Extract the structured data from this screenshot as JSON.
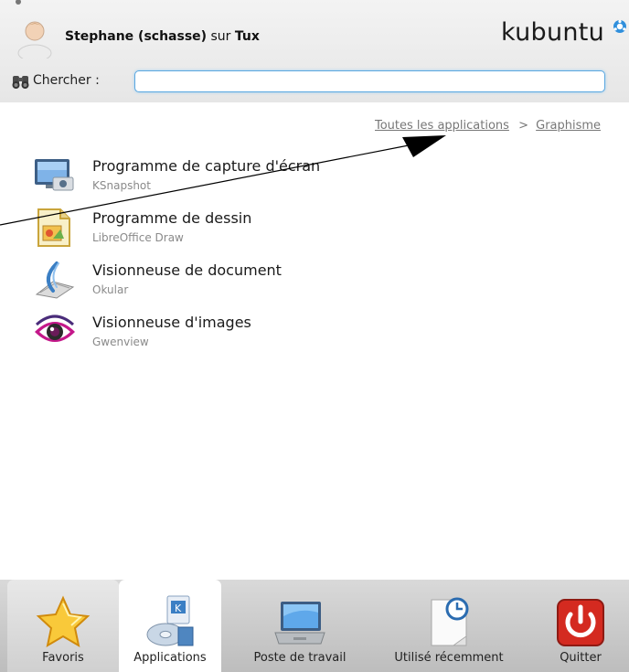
{
  "header": {
    "user_name": "Stephane (schasse)",
    "connector": "sur",
    "host": "Tux",
    "brand": "kubuntu"
  },
  "search": {
    "label": "Chercher :",
    "value": "",
    "placeholder": ""
  },
  "breadcrumb": {
    "root": "Toutes les applications",
    "separator": ">",
    "current": "Graphisme"
  },
  "apps": [
    {
      "title": "Programme de capture d'écran",
      "subtitle": "KSnapshot",
      "icon": "ksnapshot-icon"
    },
    {
      "title": "Programme de dessin",
      "subtitle": "LibreOffice Draw",
      "icon": "libreoffice-draw-icon"
    },
    {
      "title": "Visionneuse de document",
      "subtitle": "Okular",
      "icon": "okular-icon"
    },
    {
      "title": "Visionneuse d'images",
      "subtitle": "Gwenview",
      "icon": "gwenview-icon"
    }
  ],
  "tabs": [
    {
      "label": "Favoris",
      "icon": "star-icon"
    },
    {
      "label": "Applications",
      "icon": "applications-icon"
    },
    {
      "label": "Poste de travail",
      "icon": "laptop-icon"
    },
    {
      "label": "Utilisé récemment",
      "icon": "recent-document-icon"
    },
    {
      "label": "Quitter",
      "icon": "power-icon"
    }
  ],
  "active_tab": "Applications",
  "colors": {
    "accent": "#5aa7e0",
    "brand_mark": "#2f8fdc",
    "quit_red": "#d42a20"
  }
}
